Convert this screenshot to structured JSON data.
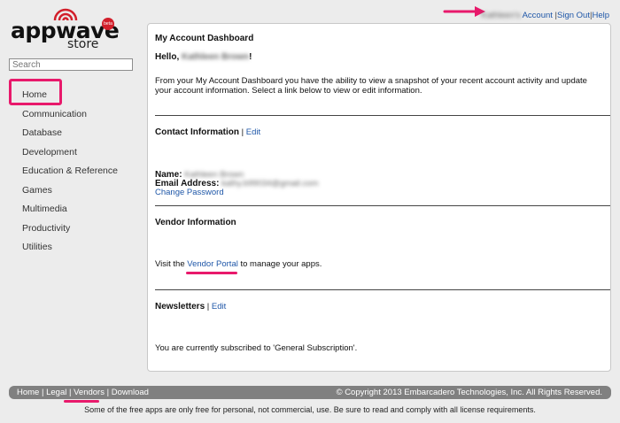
{
  "brand": {
    "logo_word": "appwave",
    "logo_sub": "store",
    "beta_badge": "beta",
    "accent_color": "#e8196b",
    "link_color": "#1f57a8"
  },
  "search": {
    "placeholder": "Search"
  },
  "sidebar": {
    "items": [
      {
        "label": "Home"
      },
      {
        "label": "Communication"
      },
      {
        "label": "Database"
      },
      {
        "label": "Development"
      },
      {
        "label": "Education & Reference"
      },
      {
        "label": "Games"
      },
      {
        "label": "Multimedia"
      },
      {
        "label": "Productivity"
      },
      {
        "label": "Utilities"
      }
    ]
  },
  "toplinks": {
    "username": "Kathleen's",
    "account": "Account",
    "separator": "|",
    "sign_out": "Sign Out",
    "help": "Help"
  },
  "dashboard": {
    "title": "My Account Dashboard",
    "greeting_prefix": "Hello, ",
    "greeting_name": "Kathleen Brown",
    "greeting_suffix": "!",
    "intro": "From your My Account Dashboard you have the ability to view a snapshot of your recent account activity and update your account information. Select a link below to view or edit information.",
    "contact": {
      "heading": "Contact Information",
      "separator": "|",
      "edit": "Edit",
      "name_label": "Name:",
      "name_value": "Kathleen Brown",
      "email_label": "Email Address:",
      "email_value": "kathy.b99034@gmail.com",
      "change_password": "Change Password"
    },
    "vendor": {
      "heading": "Vendor Information",
      "text_prefix": "Visit the ",
      "portal_link": "Vendor Portal",
      "text_suffix": " to manage your apps."
    },
    "newsletters": {
      "heading": "Newsletters",
      "separator": "|",
      "edit": "Edit",
      "status_text": "You are currently subscribed to 'General Subscription'."
    }
  },
  "footer": {
    "links": [
      {
        "label": "Home"
      },
      {
        "label": "Legal"
      },
      {
        "label": "Vendors"
      },
      {
        "label": "Download"
      }
    ],
    "separator": "|",
    "copyright": "© Copyright 2013 Embarcadero Technologies, Inc. All Rights Reserved.",
    "disclaimer": "Some of the free apps are only free for personal, not commercial, use. Be sure to read and comply with all license requirements."
  }
}
